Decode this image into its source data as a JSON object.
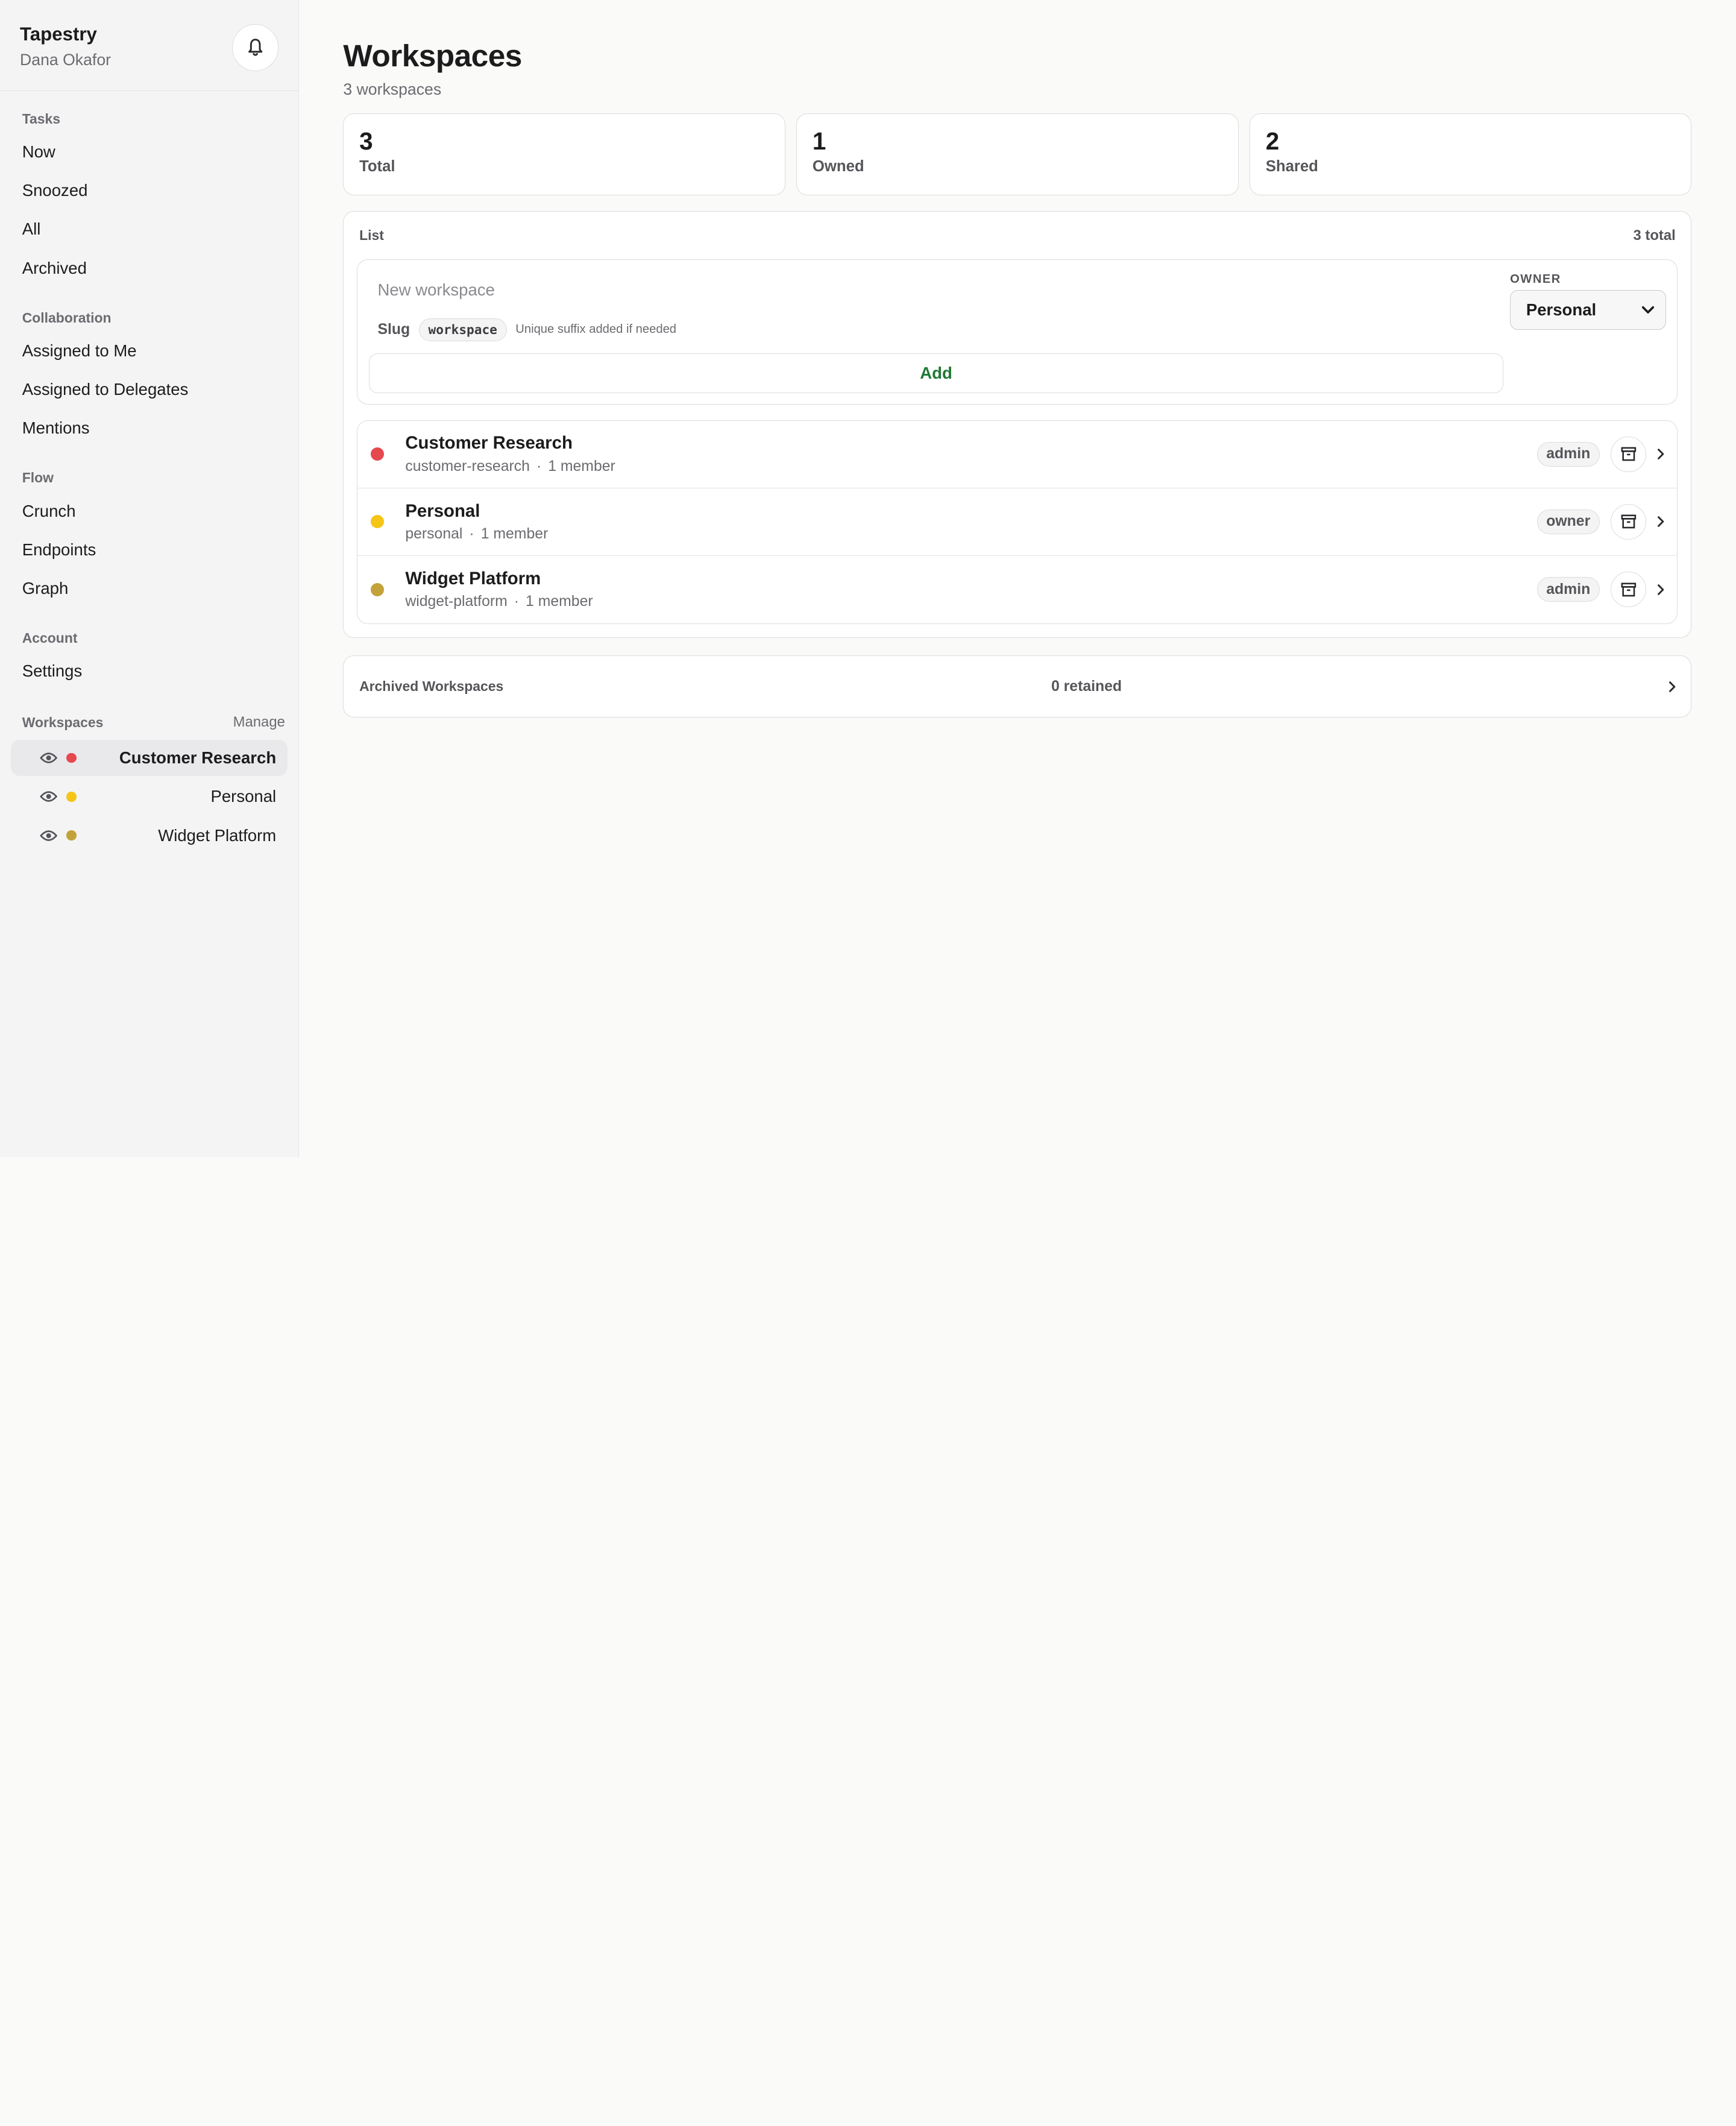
{
  "app": {
    "name": "Tapestry",
    "user": "Dana Okafor"
  },
  "sidebar": {
    "sections": [
      {
        "title": "Tasks",
        "items": [
          "Now",
          "Snoozed",
          "All",
          "Archived"
        ]
      },
      {
        "title": "Collaboration",
        "items": [
          "Assigned to Me",
          "Assigned to Delegates",
          "Mentions"
        ]
      },
      {
        "title": "Flow",
        "items": [
          "Crunch",
          "Endpoints",
          "Graph"
        ]
      },
      {
        "title": "Account",
        "items": [
          "Settings"
        ]
      }
    ],
    "workspaces_title": "Workspaces",
    "manage_label": "Manage",
    "workspaces": [
      {
        "name": "Customer Research",
        "color": "#e5484d",
        "active": true
      },
      {
        "name": "Personal",
        "color": "#f5c518",
        "active": false
      },
      {
        "name": "Widget Platform",
        "color": "#c4a23a",
        "active": false
      }
    ]
  },
  "main": {
    "title": "Workspaces",
    "subtitle": "3 workspaces",
    "stats": [
      {
        "value": "3",
        "label": "Total"
      },
      {
        "value": "1",
        "label": "Owned"
      },
      {
        "value": "2",
        "label": "Shared"
      }
    ],
    "list": {
      "title": "List",
      "total": "3 total",
      "new_placeholder": "New workspace",
      "slug_label": "Slug",
      "slug_value": "workspace",
      "slug_hint": "Unique suffix added if needed",
      "add_label": "Add",
      "owner_label": "OWNER",
      "owner_value": "Personal",
      "rows": [
        {
          "name": "Customer Research",
          "slug": "customer-research",
          "members": "1 member",
          "role": "admin",
          "color": "#e5484d"
        },
        {
          "name": "Personal",
          "slug": "personal",
          "members": "1 member",
          "role": "owner",
          "color": "#f5c518"
        },
        {
          "name": "Widget Platform",
          "slug": "widget-platform",
          "members": "1 member",
          "role": "admin",
          "color": "#c4a23a"
        }
      ]
    },
    "archived": {
      "title": "Archived Workspaces",
      "count": "0 retained"
    }
  },
  "icons": {
    "bell": "bell-icon",
    "eye": "eye-icon",
    "archive": "archive-icon",
    "chevron": "chevron-right-icon"
  }
}
